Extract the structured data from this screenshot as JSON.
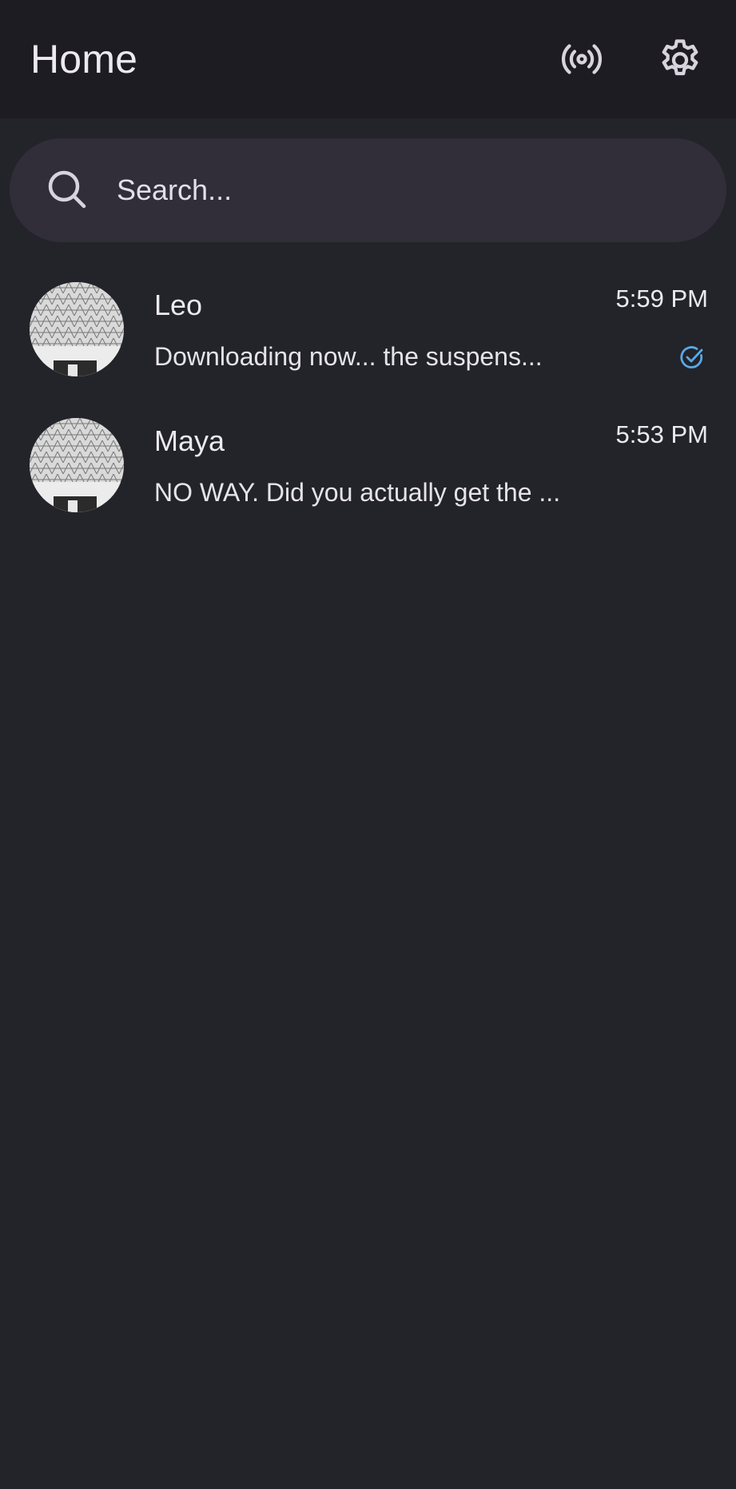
{
  "header": {
    "title": "Home",
    "broadcast_icon": "broadcast-icon",
    "settings_icon": "gear-icon"
  },
  "search": {
    "placeholder": "Search...",
    "icon": "search-icon"
  },
  "chats": [
    {
      "name": "Leo",
      "time": "5:59 PM",
      "preview": "Downloading now... the suspens...",
      "status": "read",
      "status_icon": "check-circle-icon",
      "status_color": "#5aa9e6"
    },
    {
      "name": "Maya",
      "time": "5:53 PM",
      "preview": "NO WAY. Did you actually get the ...",
      "status": "",
      "status_icon": "",
      "status_color": ""
    }
  ],
  "colors": {
    "background": "#23232a",
    "topbar": "#1d1c22",
    "search_background": "#312d39",
    "text": "#ece9f0",
    "accent": "#5aa9e6"
  }
}
